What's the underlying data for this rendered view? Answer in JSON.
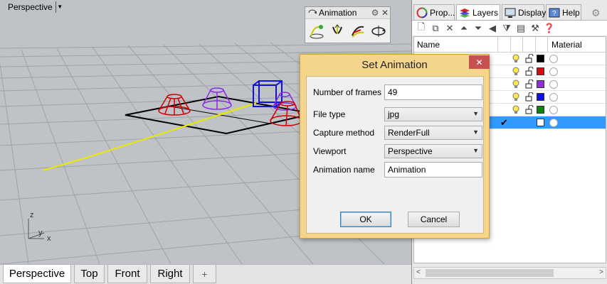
{
  "viewport": {
    "title": "Perspective",
    "axes": {
      "z": "z",
      "y": "y",
      "x": "x"
    }
  },
  "animation_toolbar": {
    "title": "Animation",
    "icons": [
      "animation-setup-icon",
      "record-animation-icon",
      "play-animation-icon",
      "turntable-icon"
    ]
  },
  "viewport_tabs": [
    "Perspective",
    "Top",
    "Front",
    "Right"
  ],
  "viewport_tabs_add": "+",
  "panel": {
    "tabs": [
      {
        "label": "Prop...",
        "icon": "properties-icon"
      },
      {
        "label": "Layers",
        "icon": "layers-icon"
      },
      {
        "label": "Display",
        "icon": "display-icon"
      },
      {
        "label": "Help",
        "icon": "help-icon"
      }
    ],
    "tools": [
      "new-layer-icon",
      "new-sublayer-icon",
      "delete-layer-icon",
      "move-up-icon",
      "move-down-icon",
      "move-left-icon",
      "filter-icon",
      "settings-list-icon",
      "tools-icon",
      "help-icon"
    ],
    "columns": {
      "name": "Name",
      "material": "Material"
    },
    "layers": [
      {
        "color": "#000000",
        "selected": false,
        "current": false
      },
      {
        "color": "#d01010",
        "selected": false,
        "current": false
      },
      {
        "color": "#9030d0",
        "selected": false,
        "current": false
      },
      {
        "color": "#1010e0",
        "selected": false,
        "current": false
      },
      {
        "color": "#108010",
        "selected": false,
        "current": false
      },
      {
        "color": "#ffffff",
        "selected": true,
        "current": true
      }
    ]
  },
  "dialog": {
    "title": "Set Animation",
    "fields": {
      "frames_label": "Number of frames",
      "frames_value": "49",
      "filetype_label": "File type",
      "filetype_value": "jpg",
      "capture_label": "Capture method",
      "capture_value": "RenderFull",
      "viewport_label": "Viewport",
      "viewport_value": "Perspective",
      "name_label": "Animation name",
      "name_value": "Animation"
    },
    "ok": "OK",
    "cancel": "Cancel"
  }
}
